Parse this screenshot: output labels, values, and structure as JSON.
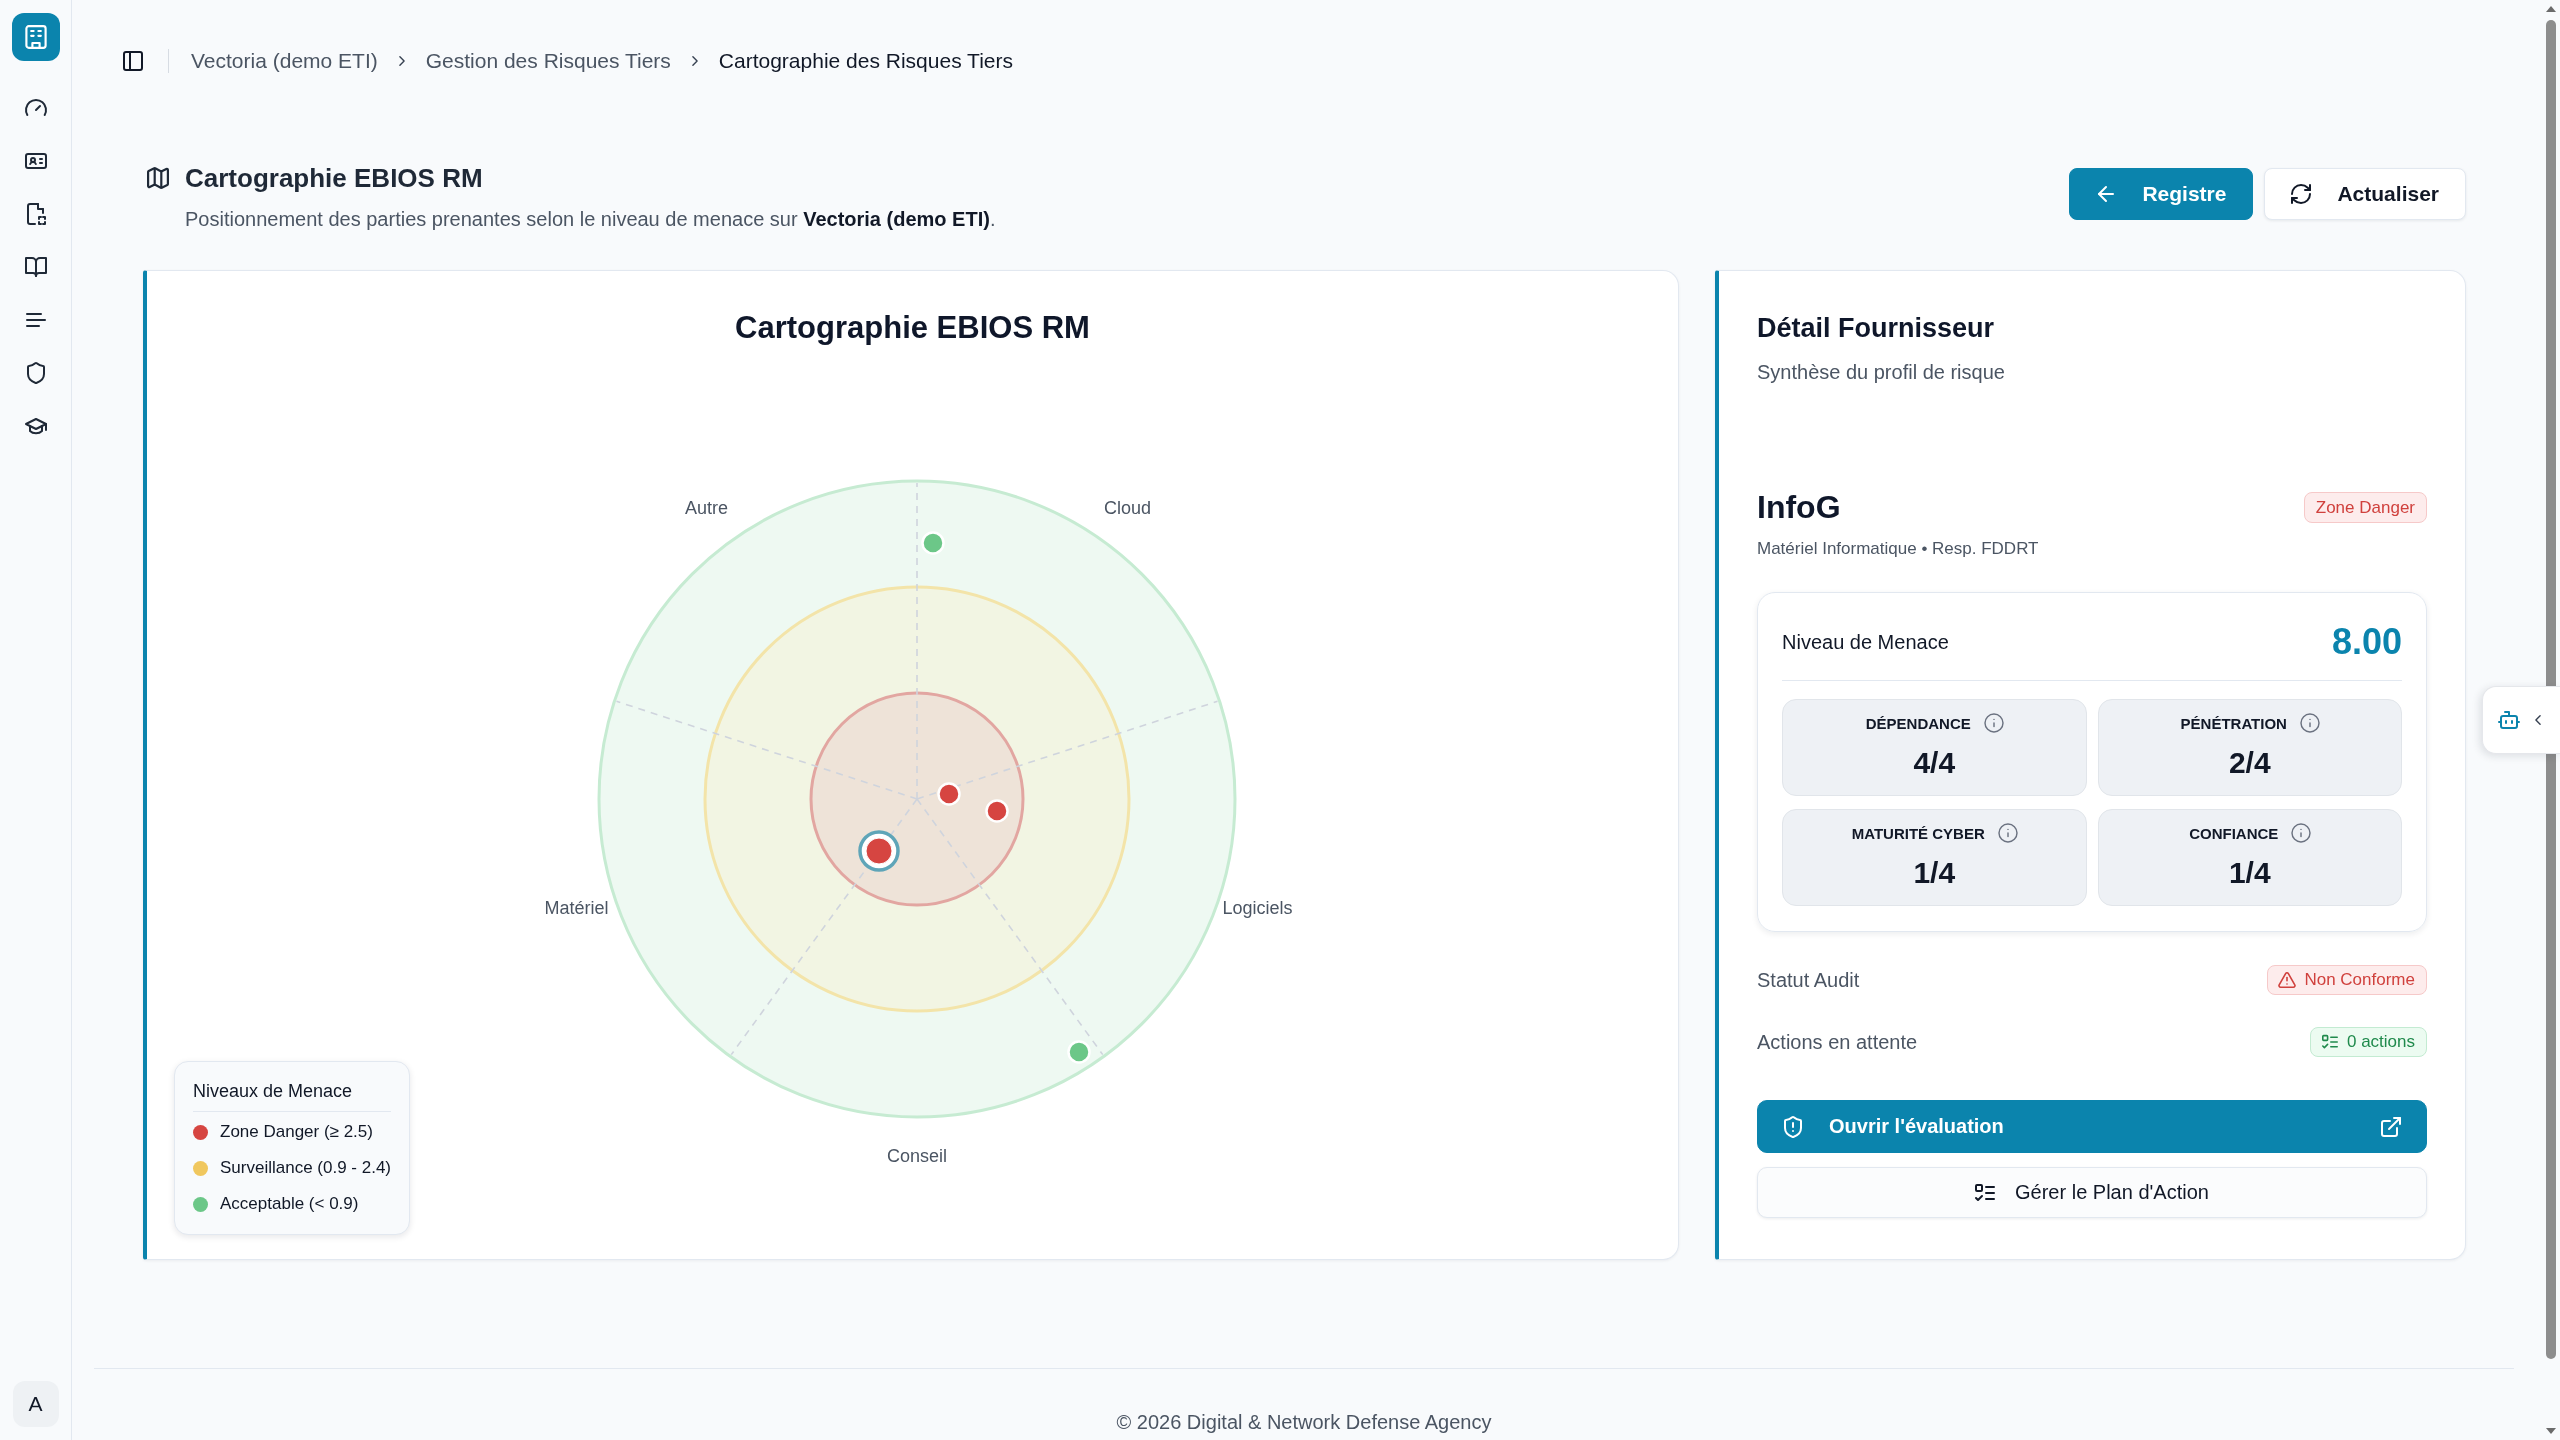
{
  "sidebar": {
    "avatar": "A"
  },
  "breadcrumb": [
    "Vectoria (demo ETI)",
    "Gestion des Risques Tiers",
    "Cartographie des Risques Tiers"
  ],
  "header": {
    "title": "Cartographie EBIOS RM",
    "subtitle": "Positionnement des parties prenantes selon le niveau de menace sur **Vectoria (demo ETI)**.",
    "actions": [
      {
        "label": "Registre",
        "kind": "primary"
      },
      {
        "label": "Actualiser",
        "kind": "secondary"
      }
    ]
  },
  "chart": {
    "title": "Cartographie EBIOS RM",
    "sectors": [
      "Cloud",
      "Logiciels",
      "Conseil",
      "Matériel",
      "Autre"
    ],
    "points": [
      {
        "color": "#6cc788",
        "selected": false
      },
      {
        "color": "#d64541",
        "selected": false
      },
      {
        "color": "#d64541",
        "selected": false
      },
      {
        "color": "#d64541",
        "selected": true
      },
      {
        "color": "#6cc788",
        "selected": false
      }
    ],
    "legend": {
      "title": "Niveaux de Menace",
      "items": [
        {
          "label": "Zone Danger (≥ 2.5)",
          "color": "#d64541"
        },
        {
          "label": "Surveillance (0.9 - 2.4)",
          "color": "#f0c75e"
        },
        {
          "label": "Acceptable (< 0.9)",
          "color": "#6cc788"
        }
      ]
    }
  },
  "detail": {
    "title": "Détail Fournisseur",
    "subtitle": "Synthèse du profil de risque",
    "supplier": {
      "name": "InfoG",
      "zone": "Zone Danger",
      "meta": "Matériel Informatique • Resp. FDDRT"
    },
    "threat": {
      "label": "Niveau de Menace",
      "value": "8.00"
    },
    "metrics": [
      {
        "label": "DÉPENDANCE",
        "value": "4/4"
      },
      {
        "label": "PÉNÉTRATION",
        "value": "2/4"
      },
      {
        "label": "MATURITÉ CYBER",
        "value": "1/4"
      },
      {
        "label": "CONFIANCE",
        "value": "1/4"
      }
    ],
    "status_rows": [
      {
        "label": "Statut Audit",
        "badge": "Non Conforme",
        "kind": "danger"
      },
      {
        "label": "Actions en attente",
        "badge": "0 actions",
        "kind": "success"
      }
    ],
    "buttons": [
      {
        "label": "Ouvrir l'évaluation",
        "kind": "primary"
      },
      {
        "label": "Gérer le Plan d'Action",
        "kind": "secondary"
      }
    ]
  },
  "footer": "© 2026 Digital & Network Defense Agency"
}
